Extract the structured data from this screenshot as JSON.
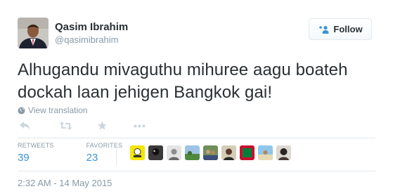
{
  "author": {
    "name": "Qasim Ibrahim",
    "handle": "@qasimibrahim"
  },
  "follow_button": {
    "label": "Follow"
  },
  "tweet": {
    "text": "Alhugandu mivaguthu mihuree aagu boateh dockah laan jehigen Bangkok gai!"
  },
  "translate": {
    "label": "View translation"
  },
  "actions": [
    "reply-icon",
    "retweet-icon",
    "favorite-icon",
    "more-icon"
  ],
  "stats": {
    "retweets_label": "RETWEETS",
    "retweets_value": "39",
    "favorites_label": "FAVORITES",
    "favorites_value": "23"
  },
  "favorited_by_count": 9,
  "timestamp": "2:32 AM - 14 May 2015",
  "colors": {
    "text": "#292f33",
    "muted": "#8899a6",
    "link": "#3b94d9",
    "border": "#e1e8ed"
  }
}
